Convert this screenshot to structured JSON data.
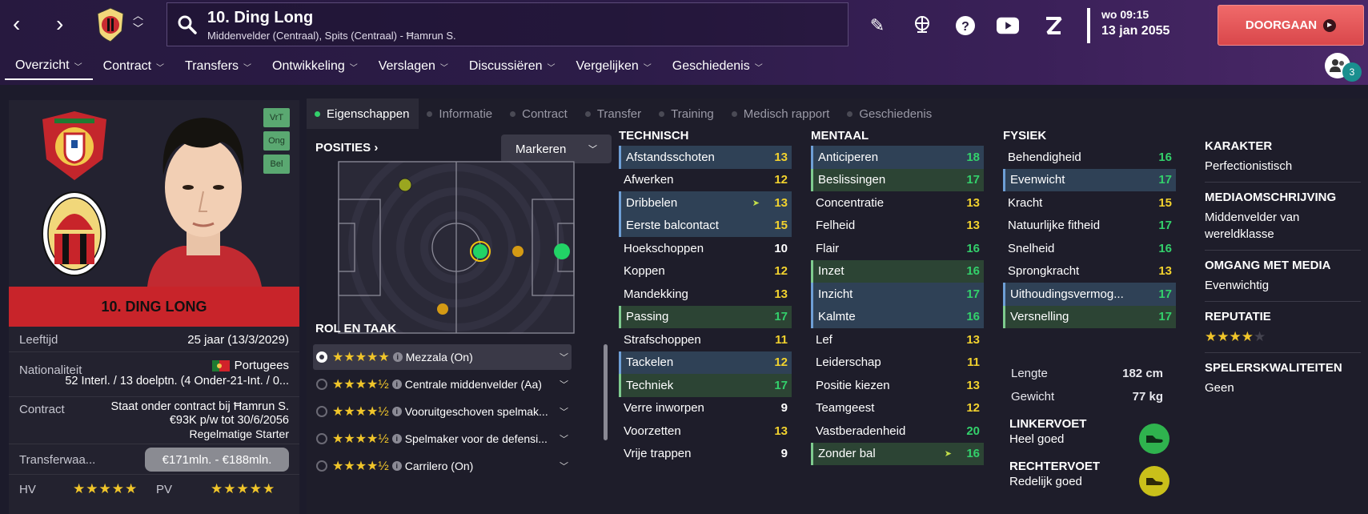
{
  "header": {
    "player_title": "10. Ding Long",
    "player_subtitle": "Middenvelder (Centraal), Spits (Centraal) - Ħamrun S.",
    "date_day_time": "wo 09:15",
    "date": "13 jan 2055",
    "continue_label": "DOORGAAN",
    "friends_count": "3"
  },
  "menu": [
    {
      "label": "Overzicht"
    },
    {
      "label": "Contract"
    },
    {
      "label": "Transfers"
    },
    {
      "label": "Ontwikkeling"
    },
    {
      "label": "Verslagen"
    },
    {
      "label": "Discussiëren"
    },
    {
      "label": "Vergelijken"
    },
    {
      "label": "Geschiedenis"
    }
  ],
  "player": {
    "name_bar": "10. DING LONG",
    "badges": [
      "VrT",
      "Ong",
      "Bel"
    ],
    "age_label": "Leeftijd",
    "age_value": "25 jaar (13/3/2029)",
    "nationality_label": "Nationaliteit",
    "nationality_value": "Portugees",
    "caps_value": "52 Interl. / 13 doelptn. (4 Onder-21-Int. / 0...",
    "contract_label": "Contract",
    "contract_line1": "Staat onder contract bij Ħamrun S.",
    "contract_line2": "€93K p/w tot 30/6/2056",
    "contract_line3": "Regelmatige Starter",
    "transfer_label": "Transferwaa...",
    "transfer_value": "€171mln. - €188mln.",
    "hv_label": "HV",
    "pv_label": "PV",
    "hv_stars": "★★★★★",
    "pv_stars": "★★★★★"
  },
  "subtabs": [
    {
      "label": "Eigenschappen"
    },
    {
      "label": "Informatie"
    },
    {
      "label": "Contract"
    },
    {
      "label": "Transfer"
    },
    {
      "label": "Training"
    },
    {
      "label": "Medisch rapport"
    },
    {
      "label": "Geschiedenis"
    }
  ],
  "positions": {
    "header": "POSITIES",
    "mark_button": "Markeren"
  },
  "roles": {
    "header": "ROL EN TAAK",
    "items": [
      {
        "stars": "★★★★★",
        "name": "Mezzala (On)"
      },
      {
        "stars": "★★★★½",
        "name": "Centrale middenvelder (Aa)"
      },
      {
        "stars": "★★★★½",
        "name": "Vooruitgeschoven spelmak..."
      },
      {
        "stars": "★★★★½",
        "name": "Spelmaker voor de defensi..."
      },
      {
        "stars": "★★★★½",
        "name": "Carrilero (On)"
      }
    ]
  },
  "technical": {
    "header": "TECHNISCH",
    "attrs": [
      {
        "name": "Afstandsschoten",
        "value": "13"
      },
      {
        "name": "Afwerken",
        "value": "12"
      },
      {
        "name": "Dribbelen",
        "value": "13"
      },
      {
        "name": "Eerste balcontact",
        "value": "15"
      },
      {
        "name": "Hoekschoppen",
        "value": "10"
      },
      {
        "name": "Koppen",
        "value": "12"
      },
      {
        "name": "Mandekking",
        "value": "13"
      },
      {
        "name": "Passing",
        "value": "17"
      },
      {
        "name": "Strafschoppen",
        "value": "11"
      },
      {
        "name": "Tackelen",
        "value": "12"
      },
      {
        "name": "Techniek",
        "value": "17"
      },
      {
        "name": "Verre inworpen",
        "value": "9"
      },
      {
        "name": "Voorzetten",
        "value": "13"
      },
      {
        "name": "Vrije trappen",
        "value": "9"
      }
    ]
  },
  "mental": {
    "header": "MENTAAL",
    "attrs": [
      {
        "name": "Anticiperen",
        "value": "18"
      },
      {
        "name": "Beslissingen",
        "value": "17"
      },
      {
        "name": "Concentratie",
        "value": "13"
      },
      {
        "name": "Felheid",
        "value": "13"
      },
      {
        "name": "Flair",
        "value": "16"
      },
      {
        "name": "Inzet",
        "value": "16"
      },
      {
        "name": "Inzicht",
        "value": "17"
      },
      {
        "name": "Kalmte",
        "value": "16"
      },
      {
        "name": "Lef",
        "value": "13"
      },
      {
        "name": "Leiderschap",
        "value": "11"
      },
      {
        "name": "Positie kiezen",
        "value": "13"
      },
      {
        "name": "Teamgeest",
        "value": "12"
      },
      {
        "name": "Vastberadenheid",
        "value": "20"
      },
      {
        "name": "Zonder bal",
        "value": "16"
      }
    ]
  },
  "physical": {
    "header": "FYSIEK",
    "attrs": [
      {
        "name": "Behendigheid",
        "value": "16"
      },
      {
        "name": "Evenwicht",
        "value": "17"
      },
      {
        "name": "Kracht",
        "value": "15"
      },
      {
        "name": "Natuurlijke fitheid",
        "value": "17"
      },
      {
        "name": "Snelheid",
        "value": "16"
      },
      {
        "name": "Sprongkracht",
        "value": "13"
      },
      {
        "name": "Uithoudingsvermog...",
        "value": "17"
      },
      {
        "name": "Versnelling",
        "value": "17"
      }
    ],
    "height_label": "Lengte",
    "height_value": "182 cm",
    "weight_label": "Gewicht",
    "weight_value": "77 kg",
    "left_foot_label": "LINKERVOET",
    "left_foot_value": "Heel goed",
    "right_foot_label": "RECHTERVOET",
    "right_foot_value": "Redelijk goed"
  },
  "side_info": {
    "character_label": "KARAKTER",
    "character_value": "Perfectionistisch",
    "media_desc_label": "MEDIAOMSCHRIJVING",
    "media_desc_value": "Middenvelder van wereldklasse",
    "media_handling_label": "OMGANG MET MEDIA",
    "media_handling_value": "Evenwichtig",
    "reputation_label": "REPUTATIE",
    "reputation_stars": "★★★★",
    "reputation_empty": "★",
    "qualities_label": "SPELERSKWALITEITEN",
    "qualities_value": "Geen"
  },
  "colors": {
    "accent_red": "#c8242a",
    "good_green": "#33d06b",
    "mid_yellow": "#f2d22e"
  }
}
